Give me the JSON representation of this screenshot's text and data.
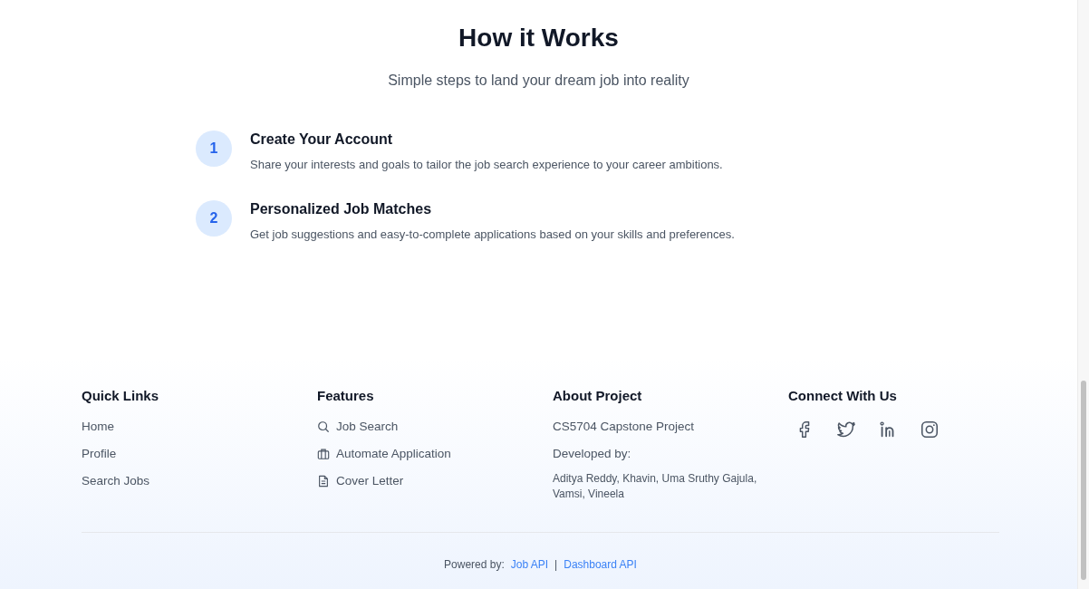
{
  "section": {
    "title": "How it Works",
    "subtitle": "Simple steps to land your dream job into reality"
  },
  "steps": [
    {
      "number": "1",
      "title": "Create Your Account",
      "description": "Share your interests and goals to tailor the job search experience to your career ambitions."
    },
    {
      "number": "2",
      "title": "Personalized Job Matches",
      "description": "Get job suggestions and easy-to-complete applications based on your skills and preferences."
    }
  ],
  "footer": {
    "quick_links": {
      "title": "Quick Links",
      "items": [
        "Home",
        "Profile",
        "Search Jobs"
      ]
    },
    "features": {
      "title": "Features",
      "items": [
        "Job Search",
        "Automate Application",
        "Cover Letter"
      ]
    },
    "about": {
      "title": "About Project",
      "project": "CS5704 Capstone Project",
      "developed_by": "Developed by:",
      "developers": "Aditya Reddy, Khavin, Uma Sruthy Gajula, Vamsi, Vineela"
    },
    "connect": {
      "title": "Connect With Us"
    },
    "powered_by": {
      "label": "Powered by:",
      "links": [
        "Job API",
        "Dashboard API"
      ],
      "separator": "|"
    }
  }
}
